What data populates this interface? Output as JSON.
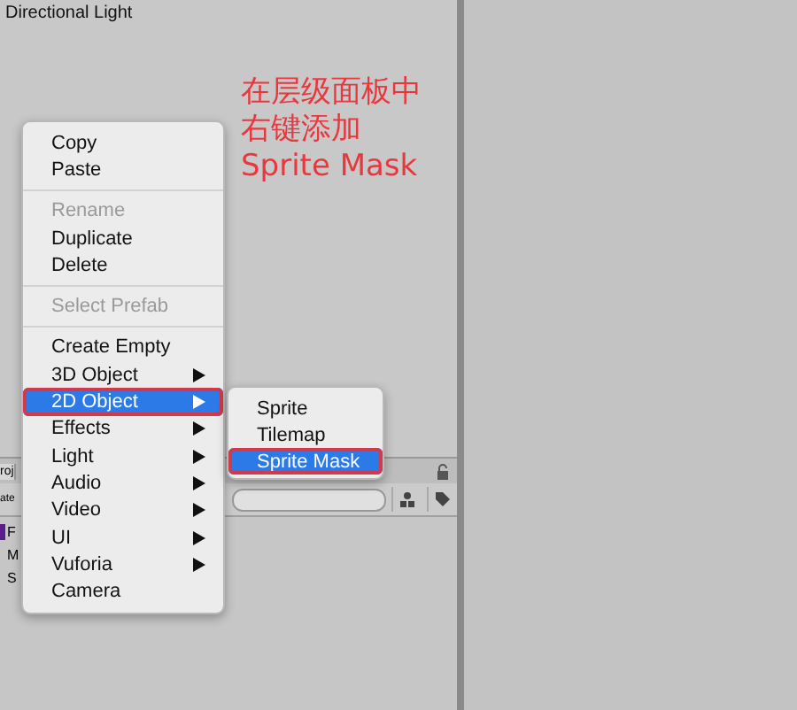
{
  "hierarchy": {
    "items": [
      {
        "label": "Directional Light"
      }
    ]
  },
  "annotation": {
    "lines": [
      "在层级面板中",
      "右键添加",
      "Sprite Mask"
    ]
  },
  "project_panel": {
    "tab": "roj",
    "search_label": "ate",
    "items": [
      {
        "label": "F",
        "kind": "folder"
      },
      {
        "label": "M",
        "kind": "plain"
      },
      {
        "label": "S",
        "kind": "plain"
      }
    ]
  },
  "context_menu": {
    "items": [
      {
        "kind": "item",
        "label": "Copy",
        "disabled": false,
        "selected": false,
        "submenu": false,
        "circled": false
      },
      {
        "kind": "item",
        "label": "Paste",
        "disabled": false,
        "selected": false,
        "submenu": false,
        "circled": false
      },
      {
        "kind": "separator"
      },
      {
        "kind": "item",
        "label": "Rename",
        "disabled": true,
        "selected": false,
        "submenu": false,
        "circled": false
      },
      {
        "kind": "item",
        "label": "Duplicate",
        "disabled": false,
        "selected": false,
        "submenu": false,
        "circled": false
      },
      {
        "kind": "item",
        "label": "Delete",
        "disabled": false,
        "selected": false,
        "submenu": false,
        "circled": false
      },
      {
        "kind": "separator"
      },
      {
        "kind": "item",
        "label": "Select Prefab",
        "disabled": true,
        "selected": false,
        "submenu": false,
        "circled": false
      },
      {
        "kind": "separator"
      },
      {
        "kind": "item",
        "label": "Create Empty",
        "disabled": false,
        "selected": false,
        "submenu": false,
        "circled": false
      },
      {
        "kind": "item",
        "label": "3D Object",
        "disabled": false,
        "selected": false,
        "submenu": true,
        "circled": false
      },
      {
        "kind": "item",
        "label": "2D Object",
        "disabled": false,
        "selected": true,
        "submenu": true,
        "circled": true
      },
      {
        "kind": "item",
        "label": "Effects",
        "disabled": false,
        "selected": false,
        "submenu": true,
        "circled": false
      },
      {
        "kind": "item",
        "label": "Light",
        "disabled": false,
        "selected": false,
        "submenu": true,
        "circled": false
      },
      {
        "kind": "item",
        "label": "Audio",
        "disabled": false,
        "selected": false,
        "submenu": true,
        "circled": false
      },
      {
        "kind": "item",
        "label": "Video",
        "disabled": false,
        "selected": false,
        "submenu": true,
        "circled": false
      },
      {
        "kind": "item",
        "label": "UI",
        "disabled": false,
        "selected": false,
        "submenu": true,
        "circled": false
      },
      {
        "kind": "item",
        "label": "Vuforia",
        "disabled": false,
        "selected": false,
        "submenu": true,
        "circled": false
      },
      {
        "kind": "item",
        "label": "Camera",
        "disabled": false,
        "selected": false,
        "submenu": false,
        "circled": false
      }
    ]
  },
  "submenu": {
    "items": [
      {
        "label": "Sprite",
        "selected": false,
        "circled": false
      },
      {
        "label": "Tilemap",
        "selected": false,
        "circled": false
      },
      {
        "label": "Sprite Mask",
        "selected": true,
        "circled": true
      }
    ]
  }
}
